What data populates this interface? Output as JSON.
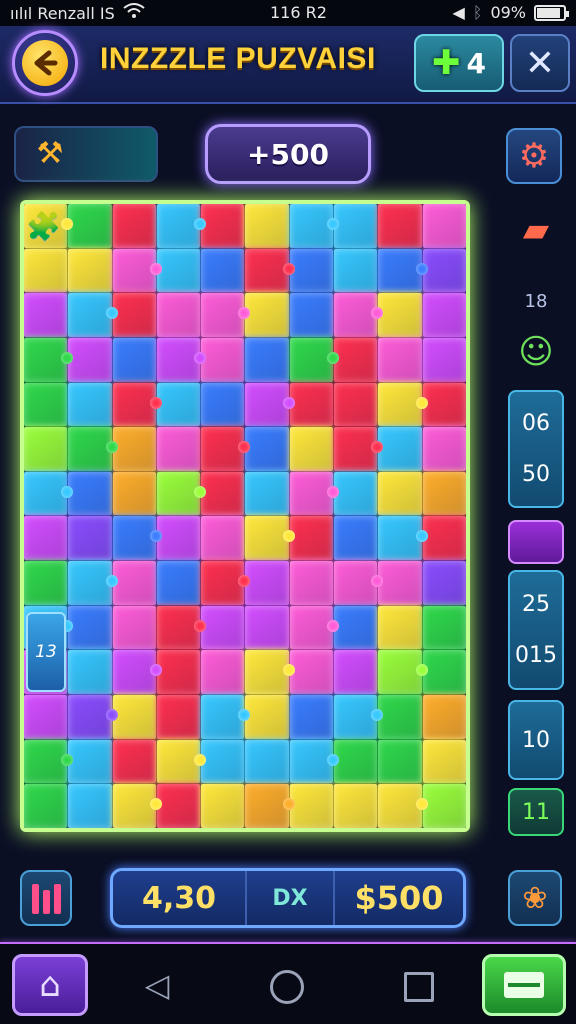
{
  "status_bar": {
    "carrier": "ıılıl Renzall IS",
    "time": "116 R2",
    "battery_percent": "09%",
    "battery_level": 0.9,
    "icons": [
      "signal-icon",
      "wifi-icon",
      "volume-icon",
      "bluetooth-icon",
      "battery-icon"
    ]
  },
  "header": {
    "back_icon": "arrow-left-icon",
    "title": "INZZZLE PUZVAISI",
    "lives_count": "4",
    "lives_icon": "plus-icon",
    "close_icon": "close-icon"
  },
  "toolbar": {
    "tool_icon": "hammer-icon",
    "score": "+500",
    "settings_icon": "gear-icon"
  },
  "board": {
    "columns": 10,
    "rows": 14,
    "palette": {
      "Y": "#ffe83a",
      "G": "#2fd94a",
      "R": "#ff2f4f",
      "C": "#36c8ff",
      "B": "#3a7dff",
      "P": "#d34dff",
      "M": "#ff5cd8",
      "O": "#ffae2a",
      "L": "#9aff3a",
      "V": "#8a4dff"
    },
    "rows_colors": [
      "YGRCRYCCRM",
      "YYMCBRBCBV",
      "PCRMMYBMYP",
      "GPBPMBGRMP",
      "GCRCBPRRYR",
      "LGOMRBYRCM",
      "CBOLRCMCYO",
      "PVBPMYRBCR",
      "GCMBRPMMMV",
      "CBMRPPMBYG",
      "PCPRMYMPLG",
      "PVYRCYBCGO",
      "GCRYCCCGGY",
      "GCYRYOYYYL"
    ],
    "corner_piece_icon": "puzzle-piece-icon",
    "side_badge": "13"
  },
  "right_panel": {
    "chest_icon": "treasure-chest-icon",
    "label_top": "18",
    "frog_icon": "frog-icon",
    "box1": [
      "06",
      "50"
    ],
    "box2": [
      "25",
      "015"
    ],
    "box3": "10",
    "box4": "11"
  },
  "bottom": {
    "bars_icon": "bar-chart-icon",
    "stat_left": "4,30",
    "stat_mid": "DX",
    "stat_right": "$500",
    "creature_icon": "monster-icon"
  },
  "nav": {
    "home_icon": "home-icon",
    "back_icon": "triangle-back-icon",
    "home_circle_icon": "circle-home-icon",
    "recent_icon": "square-recent-icon",
    "menu_icon": "menu-icon"
  }
}
